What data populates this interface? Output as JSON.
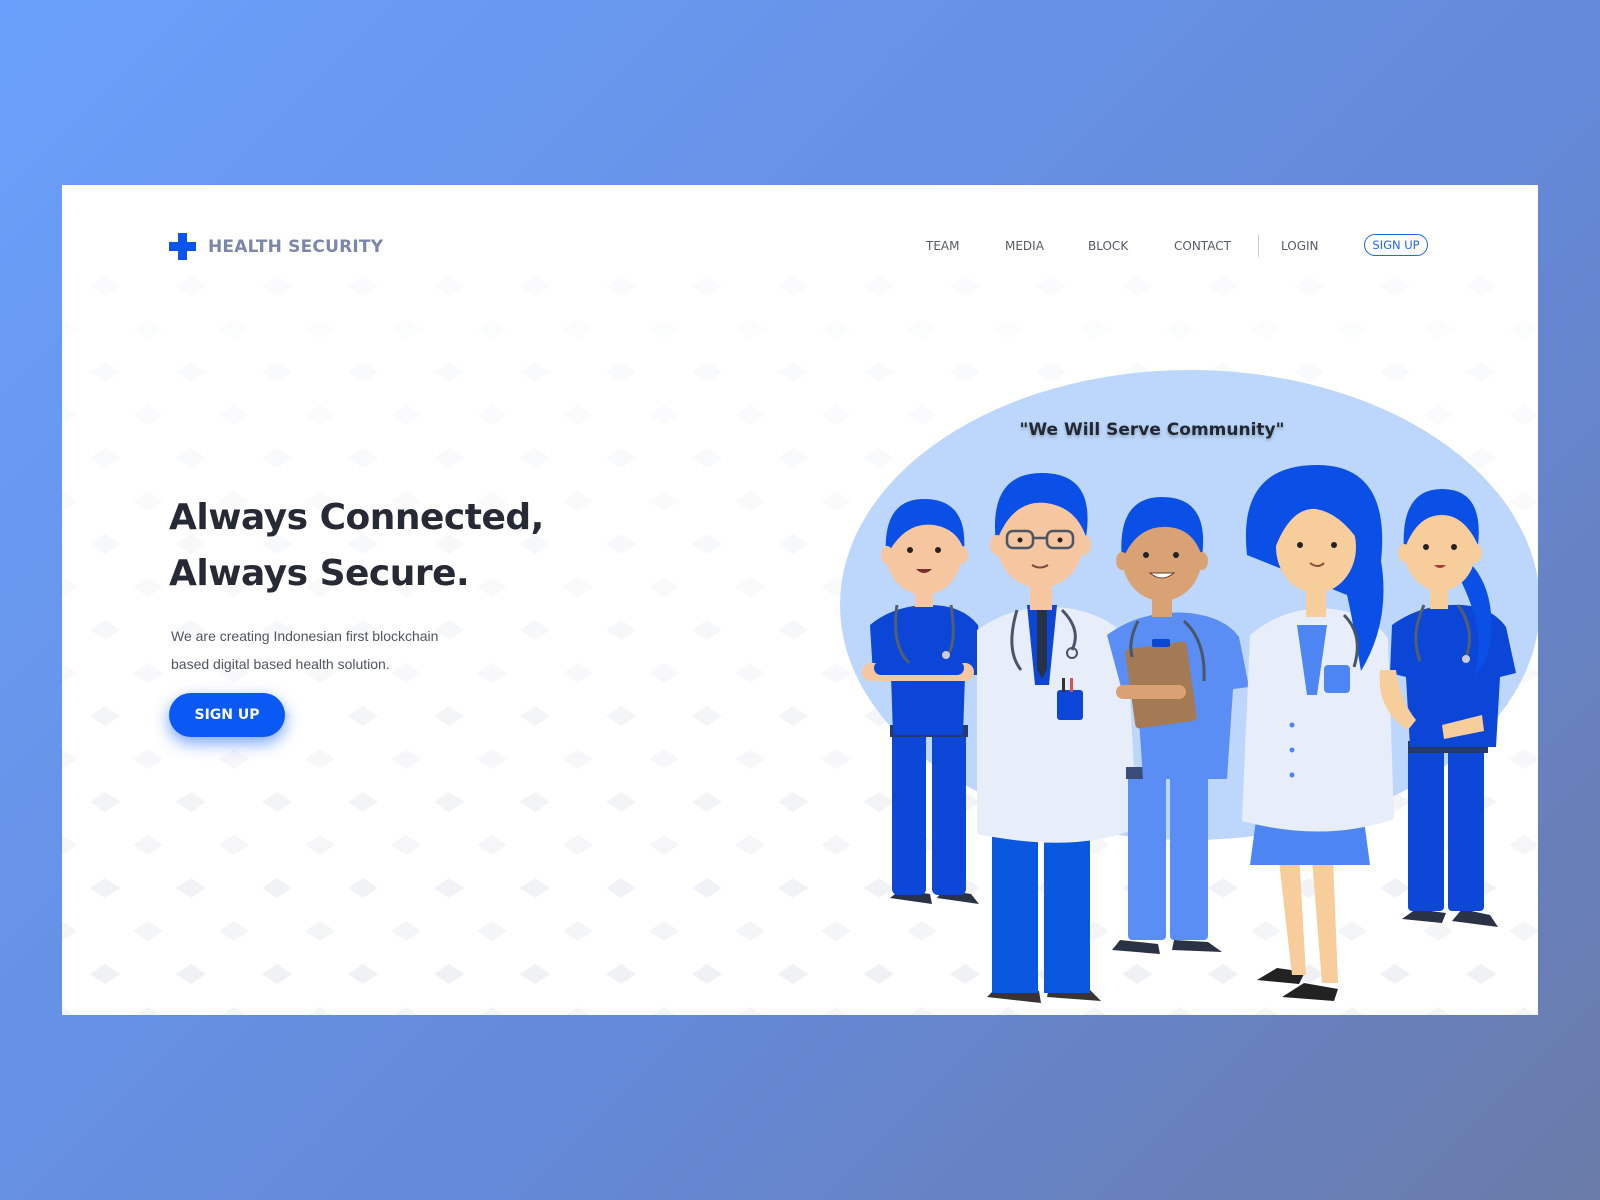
{
  "brand": {
    "name": "HEALTH SECURITY",
    "icon": "medical-cross-icon",
    "accent": "#0a55f0"
  },
  "nav": {
    "items": [
      "TEAM",
      "MEDIA",
      "BLOCK",
      "CONTACT",
      "LOGIN"
    ],
    "signup": "SIGN UP"
  },
  "hero": {
    "title_line1": "Always Connected,",
    "title_line2": "Always Secure.",
    "subtitle": "We are creating Indonesian first blockchain based digital based health solution.",
    "cta": "SIGN UP"
  },
  "illustration": {
    "quote": "\"We Will Serve Community\""
  },
  "colors": {
    "background_start": "#6aa0fb",
    "background_end": "#6a7ba8",
    "primary": "#0a59f5",
    "blob": "#bcd7fb"
  }
}
